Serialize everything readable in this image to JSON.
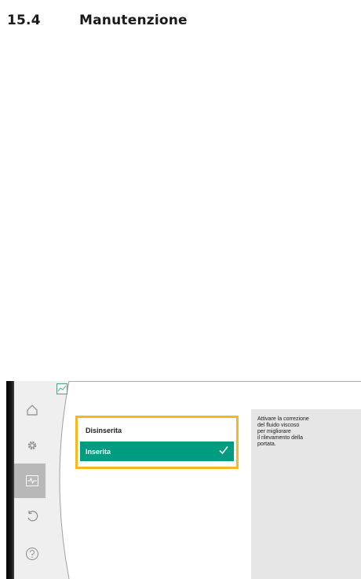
{
  "heading": {
    "number": "15.4",
    "title": "Manutenzione"
  },
  "sidebar": {
    "items": [
      {
        "icon": "home-icon",
        "active": false
      },
      {
        "icon": "gear-icon",
        "active": false
      },
      {
        "icon": "diagnostics-icon",
        "active": true
      },
      {
        "icon": "undo-icon",
        "active": false
      },
      {
        "icon": "help-icon",
        "active": false
      }
    ]
  },
  "options": {
    "off_label": "Disinserita",
    "on_label": "Inserita",
    "selected": "Inserita"
  },
  "help": {
    "text": "Attivare la correzione\ndel fluido viscoso\nper migliorare\nil rilevamento della\nportata."
  },
  "colors": {
    "accent": "#009c82",
    "focus": "#f5b820",
    "panel": "#e6e6e6",
    "sidebar": "#efefef",
    "sidebar_active": "#b8b8b8"
  }
}
